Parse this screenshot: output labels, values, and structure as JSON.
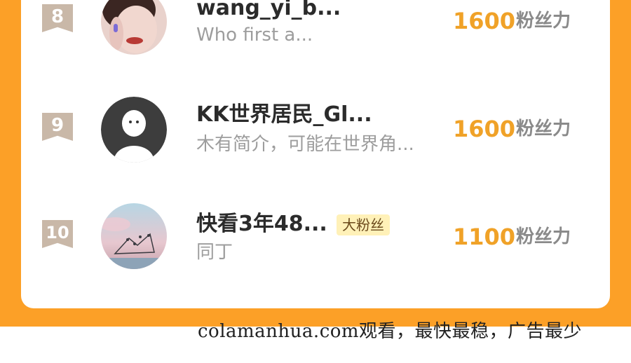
{
  "ranking": [
    {
      "rank": "8",
      "name": "wang_yi_b...",
      "desc": "Who first a...",
      "badge": "",
      "score": "1600",
      "unit": "粉丝力",
      "avatar": "photo-avatar"
    },
    {
      "rank": "9",
      "name": "KK世界居民_Gl...",
      "desc": "木有简介，可能在世界角...",
      "badge": "",
      "score": "1600",
      "unit": "粉丝力",
      "avatar": "default-avatar"
    },
    {
      "rank": "10",
      "name": "快看3年48...",
      "desc": "同丁",
      "badge": "大粉丝",
      "score": "1100",
      "unit": "粉丝力",
      "avatar": "landscape-avatar"
    }
  ],
  "watermark": "colamanhua.com观看，最快最稳，广告最少",
  "colors": {
    "background": "#fca027",
    "score": "#f0a228",
    "rank_ribbon": "#c9b8a8",
    "badge_bg": "#fff1b8"
  }
}
